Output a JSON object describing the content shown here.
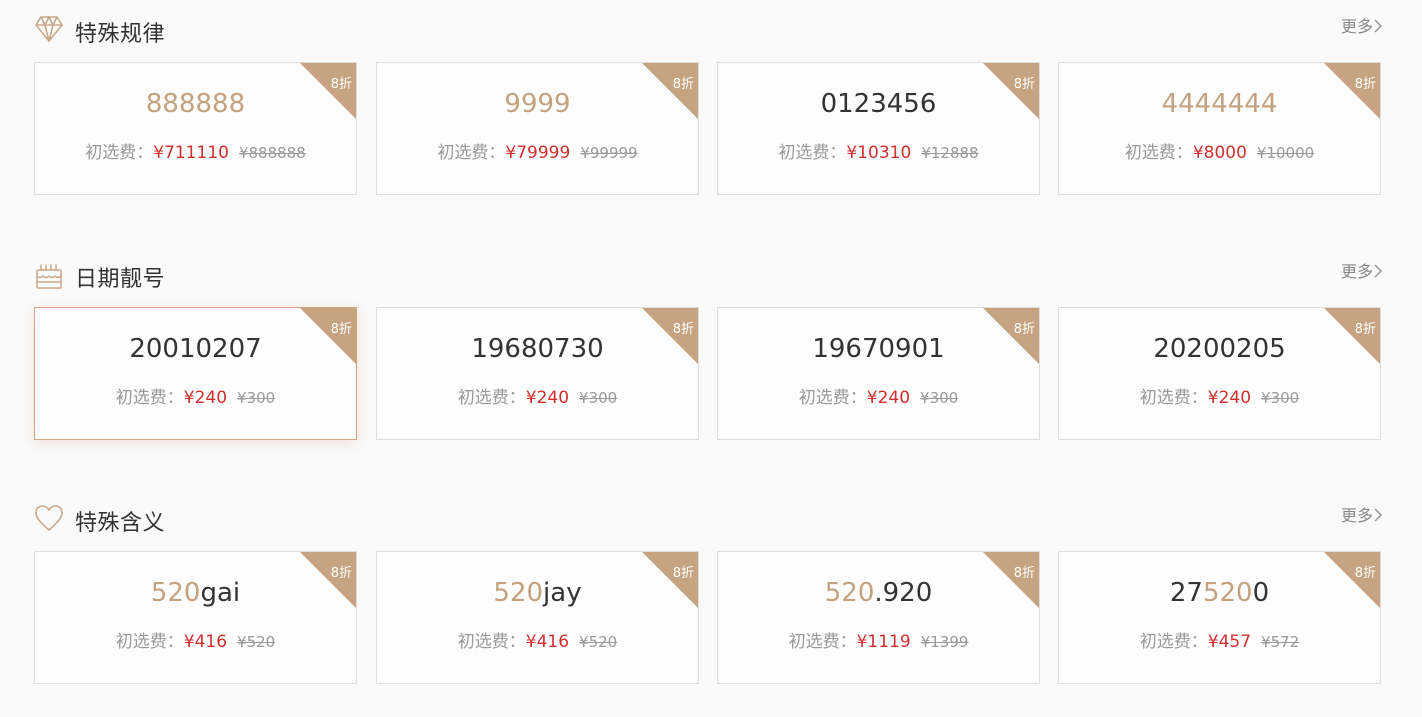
{
  "more_label": "更多",
  "price_label": "初选费：",
  "sections": [
    {
      "title": "特殊规律",
      "icon": "diamond-icon",
      "cards": [
        {
          "number_parts": [
            {
              "text": "888888",
              "hl": true
            }
          ],
          "discount": "8折",
          "price": "¥711110",
          "original": "¥888888"
        },
        {
          "number_parts": [
            {
              "text": "9999",
              "hl": true
            }
          ],
          "discount": "8折",
          "price": "¥79999",
          "original": "¥99999"
        },
        {
          "number_parts": [
            {
              "text": "0123456",
              "hl": false
            }
          ],
          "discount": "8折",
          "price": "¥10310",
          "original": "¥12888"
        },
        {
          "number_parts": [
            {
              "text": "4444444",
              "hl": true
            }
          ],
          "discount": "8折",
          "price": "¥8000",
          "original": "¥10000"
        }
      ]
    },
    {
      "title": "日期靓号",
      "icon": "birthday-cake-icon",
      "cards": [
        {
          "number_parts": [
            {
              "text": "20010207",
              "hl": false
            }
          ],
          "discount": "8折",
          "price": "¥240",
          "original": "¥300"
        },
        {
          "number_parts": [
            {
              "text": "19680730",
              "hl": false
            }
          ],
          "discount": "8折",
          "price": "¥240",
          "original": "¥300"
        },
        {
          "number_parts": [
            {
              "text": "19670901",
              "hl": false
            }
          ],
          "discount": "8折",
          "price": "¥240",
          "original": "¥300"
        },
        {
          "number_parts": [
            {
              "text": "20200205",
              "hl": false
            }
          ],
          "discount": "8折",
          "price": "¥240",
          "original": "¥300"
        }
      ]
    },
    {
      "title": "特殊含义",
      "icon": "heart-icon",
      "cards": [
        {
          "number_parts": [
            {
              "text": "520",
              "hl": true
            },
            {
              "text": "gai",
              "hl": false
            }
          ],
          "discount": "8折",
          "price": "¥416",
          "original": "¥520"
        },
        {
          "number_parts": [
            {
              "text": "520",
              "hl": true
            },
            {
              "text": "jay",
              "hl": false
            }
          ],
          "discount": "8折",
          "price": "¥416",
          "original": "¥520"
        },
        {
          "number_parts": [
            {
              "text": "520",
              "hl": true
            },
            {
              "text": ".920",
              "hl": false
            }
          ],
          "discount": "8折",
          "price": "¥1119",
          "original": "¥1399"
        },
        {
          "number_parts": [
            {
              "text": "27",
              "hl": false
            },
            {
              "text": "520",
              "hl": true
            },
            {
              "text": "0",
              "hl": false
            }
          ],
          "discount": "8折",
          "price": "¥457",
          "original": "¥572"
        }
      ]
    }
  ]
}
